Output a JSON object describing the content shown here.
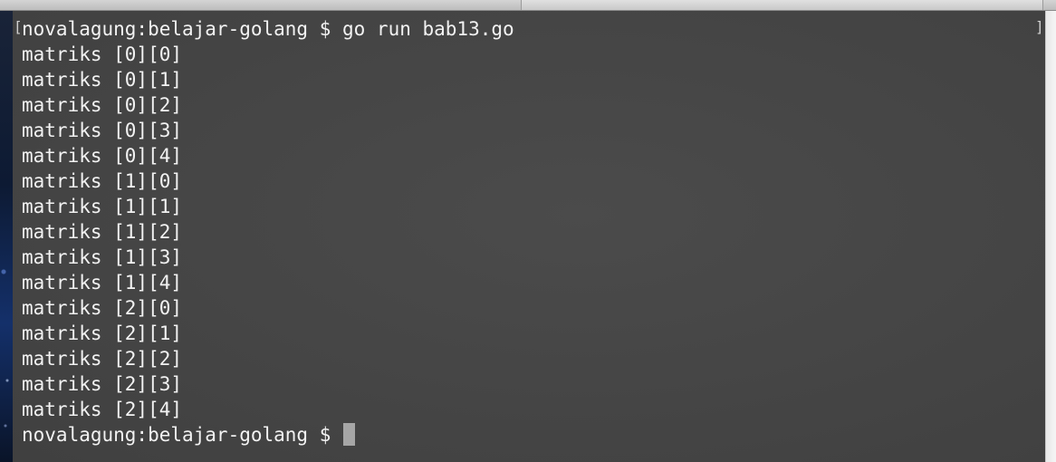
{
  "terminal": {
    "command_line": "novalagung:belajar-golang $ go run bab13.go",
    "output_lines": [
      "matriks [0][0]",
      "matriks [0][1]",
      "matriks [0][2]",
      "matriks [0][3]",
      "matriks [0][4]",
      "matriks [1][0]",
      "matriks [1][1]",
      "matriks [1][2]",
      "matriks [1][3]",
      "matriks [1][4]",
      "matriks [2][0]",
      "matriks [2][1]",
      "matriks [2][2]",
      "matriks [2][3]",
      "matriks [2][4]"
    ],
    "prompt": "novalagung:belajar-golang $ ",
    "bracket_left": "[",
    "bracket_right": "]"
  },
  "colors": {
    "terminal_background": "#454545",
    "terminal_text": "#f2f2f2",
    "cursor": "#a6a6a6"
  }
}
